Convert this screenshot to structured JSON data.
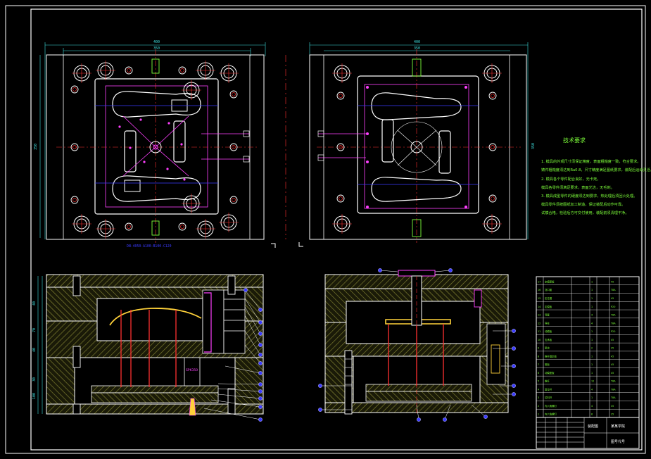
{
  "drawing": {
    "top_left_caption": "DN-4050-A100-B100-C120",
    "left_plan_dim_width": "400",
    "left_plan_dim_inner": "350",
    "left_plan_dim_height": "350",
    "right_plan_dim_width": "400",
    "right_plan_dim_inner": "350",
    "right_plan_dim_height": "350",
    "left_section_dims": [
      "40",
      "70",
      "40",
      "30",
      "100"
    ],
    "core_tag": "SPK350"
  },
  "technical_requirements": {
    "title": "技术要求",
    "items": [
      "1. 模具的外观尺寸须保证精度，表面粗糙度一致，符合要求。",
      "铸件粗糙度须达到Ra0.8，尺寸精度满足图纸要求，装配后运动灵活。",
      "2. 模具各个零件配合良好，无卡死。",
      "模具各零件须满足要求，表面光洁，无毛刺。",
      "3. 模具成型零件的硬度须达到要求，热处理后须回火处理。",
      "模具零件须按图纸加工制造，保证装配后动作可靠。",
      "试模合格，检验后方可交付使用，装配前须清理干净。"
    ]
  },
  "bom": {
    "rows": [
      [
        "17",
        "定模座板",
        "1",
        "45"
      ],
      [
        "16",
        "浇口套",
        "1",
        "T8A"
      ],
      [
        "15",
        "定位圈",
        "1",
        "45"
      ],
      [
        "14",
        "定模板",
        "1",
        "P20"
      ],
      [
        "13",
        "导套",
        "4",
        "T8A"
      ],
      [
        "12",
        "导柱",
        "4",
        "T8A"
      ],
      [
        "11",
        "动模板",
        "1",
        "P20"
      ],
      [
        "10",
        "支承板",
        "1",
        "45"
      ],
      [
        "9",
        "垫块",
        "2",
        "45"
      ],
      [
        "8",
        "推杆固定板",
        "1",
        "45"
      ],
      [
        "7",
        "推板",
        "1",
        "45"
      ],
      [
        "6",
        "动模座板",
        "1",
        "45"
      ],
      [
        "5",
        "推杆",
        "12",
        "T8A"
      ],
      [
        "4",
        "复位杆",
        "4",
        "T8A"
      ],
      [
        "3",
        "拉料杆",
        "1",
        "T8A"
      ],
      [
        "2",
        "内六角螺钉",
        "4",
        "35"
      ],
      [
        "1",
        "内六角螺钉",
        "6",
        "35"
      ]
    ]
  },
  "title_block": {
    "drawing_name": "装配图",
    "school": "某某学院",
    "drawing_number": "图号代号"
  },
  "colors": {
    "background": "#000000",
    "outline": "#ffffff",
    "dimension": "#3fe0e0",
    "centerline": "#ff3030",
    "part": "#ff40ff",
    "note": "#7dff3a",
    "hatch": "#9a9a3a"
  }
}
